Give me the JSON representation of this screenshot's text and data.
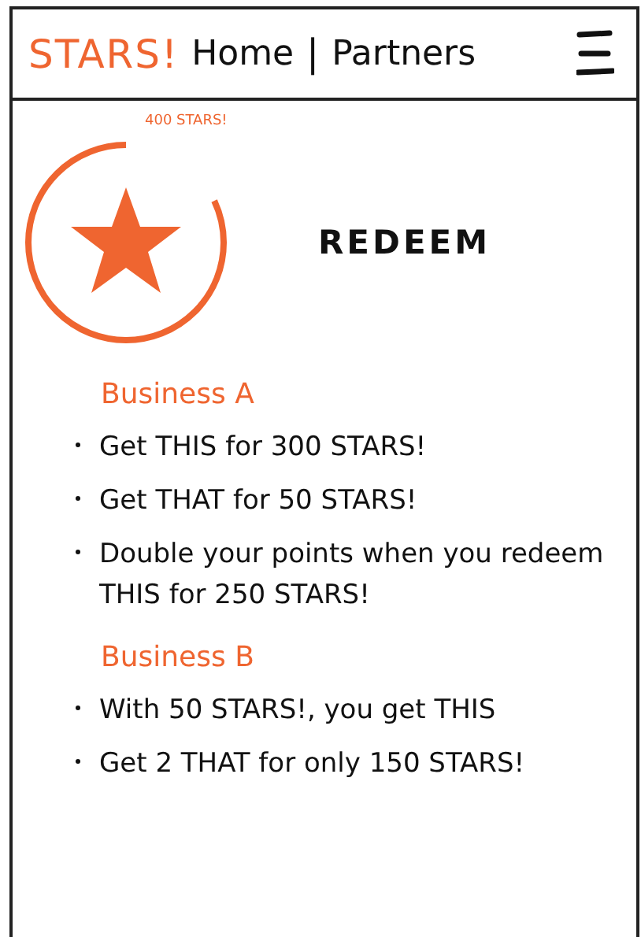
{
  "header": {
    "logo": "STARS!",
    "nav": [
      {
        "label": "Home"
      },
      {
        "label": "Partners"
      }
    ],
    "separator": "|"
  },
  "balance": {
    "label": "400 STARS!",
    "level": 0.82
  },
  "title": "REDEEM",
  "businesses": [
    {
      "name": "Business A",
      "offers": [
        "Get THIS for 300 STARS!",
        "Get THAT for 50 STARS!",
        "Double your points when you redeem THIS for 250 STARS!"
      ]
    },
    {
      "name": "Business B",
      "offers": [
        "With 50 STARS!, you get THIS",
        "Get 2 THAT for only 150 STARS!"
      ]
    }
  ]
}
